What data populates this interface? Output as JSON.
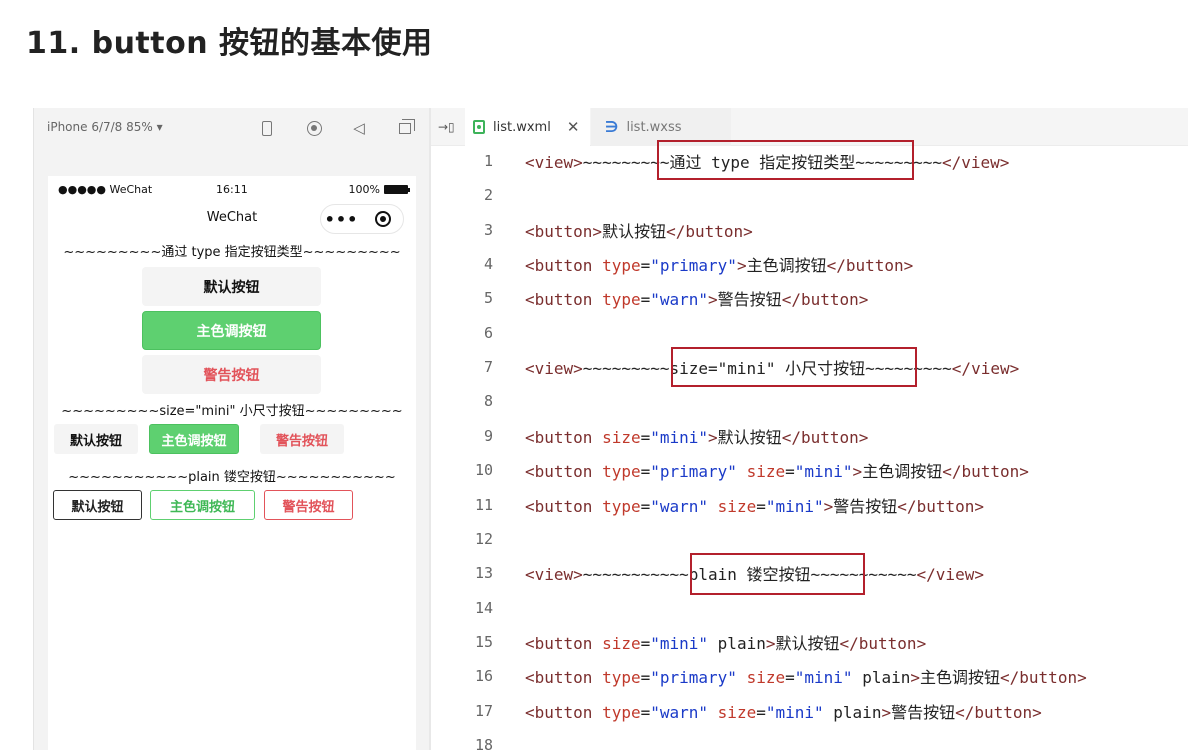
{
  "page_title": "11. button 按钮的基本使用",
  "simulator": {
    "device": "iPhone 6/7/8 85% ▾",
    "status_bar": {
      "carrier": "●●●●● WeChat",
      "time": "16:11",
      "battery": "100%"
    },
    "nav_title": "WeChat",
    "capsule_more": "•••",
    "sections": [
      {
        "view_text": "~~~~~~~~~通过 type 指定按钮类型~~~~~~~~~"
      },
      {
        "view_text": "~~~~~~~~~size=\"mini\" 小尺寸按钮~~~~~~~~~"
      },
      {
        "view_text": "~~~~~~~~~~~plain 镂空按钮~~~~~~~~~~~"
      }
    ],
    "buttons": {
      "default": "默认按钮",
      "primary": "主色调按钮",
      "warn": "警告按钮"
    }
  },
  "editor": {
    "tabs": [
      {
        "label": "list.wxml",
        "active": true
      },
      {
        "label": "list.wxss",
        "active": false
      }
    ],
    "lines": [
      {
        "n": "1",
        "t1": "<view>",
        "a": "~~~~~~~~~通过 type 指定按钮类型~~~~~~~~~",
        "t2": "</view>"
      },
      {
        "n": "2"
      },
      {
        "n": "3",
        "t1": "<button>",
        "a": "默认按钮",
        "t2": "</button>"
      },
      {
        "n": "4",
        "t1": "<button ",
        "k1": "type",
        "eq1": "=",
        "v1": "\"primary\"",
        "t1b": ">",
        "a": "主色调按钮",
        "t2": "</button>"
      },
      {
        "n": "5",
        "t1": "<button ",
        "k1": "type",
        "eq1": "=",
        "v1": "\"warn\"",
        "t1b": ">",
        "a": "警告按钮",
        "t2": "</button>"
      },
      {
        "n": "6"
      },
      {
        "n": "7",
        "t1": "<view>",
        "a": "~~~~~~~~~size=\"mini\" 小尺寸按钮~~~~~~~~~",
        "t2": "</view>"
      },
      {
        "n": "8"
      },
      {
        "n": "9",
        "t1": "<button ",
        "k1": "size",
        "eq1": "=",
        "v1": "\"mini\"",
        "t1b": ">",
        "a": "默认按钮",
        "t2": "</button>"
      },
      {
        "n": "10",
        "t1": "<button ",
        "k1": "type",
        "eq1": "=",
        "v1": "\"primary\"",
        "k2": "size",
        "eq2": "=",
        "v2": "\"mini\"",
        "t1b": ">",
        "a": "主色调按钮",
        "t2": "</button>"
      },
      {
        "n": "11",
        "t1": "<button ",
        "k1": "type",
        "eq1": "=",
        "v1": "\"warn\"",
        "k2": "size",
        "eq2": "=",
        "v2": "\"mini\"",
        "t1b": ">",
        "a": "警告按钮",
        "t2": "</button>"
      },
      {
        "n": "12"
      },
      {
        "n": "13",
        "t1": "<view>",
        "a": "~~~~~~~~~~~plain 镂空按钮~~~~~~~~~~~",
        "t2": "</view>"
      },
      {
        "n": "14"
      },
      {
        "n": "15",
        "t1": "<button ",
        "k1": "size",
        "eq1": "=",
        "v1": "\"mini\"",
        "plain": "plain",
        "t1b": ">",
        "a": "默认按钮",
        "t2": "</button>"
      },
      {
        "n": "16",
        "t1": "<button ",
        "k1": "type",
        "eq1": "=",
        "v1": "\"primary\"",
        "k2": "size",
        "eq2": "=",
        "v2": "\"mini\"",
        "plain": "plain",
        "t1b": ">",
        "a": "主色调按钮",
        "t2": "</button>"
      },
      {
        "n": "17",
        "t1": "<button ",
        "k1": "type",
        "eq1": "=",
        "v1": "\"warn\"",
        "k2": "size",
        "eq2": "=",
        "v2": "\"mini\"",
        "plain": "plain",
        "t1b": ">",
        "a": "警告按钮",
        "t2": "</button>"
      },
      {
        "n": "18"
      }
    ]
  },
  "colors": {
    "primary_green": "#5ed070",
    "warn_red": "#e2535a",
    "highlight_red": "#b3202c",
    "tag_color": "#7a2e2e",
    "attr_color": "#c0392b",
    "string_color": "#1a3ac8"
  }
}
